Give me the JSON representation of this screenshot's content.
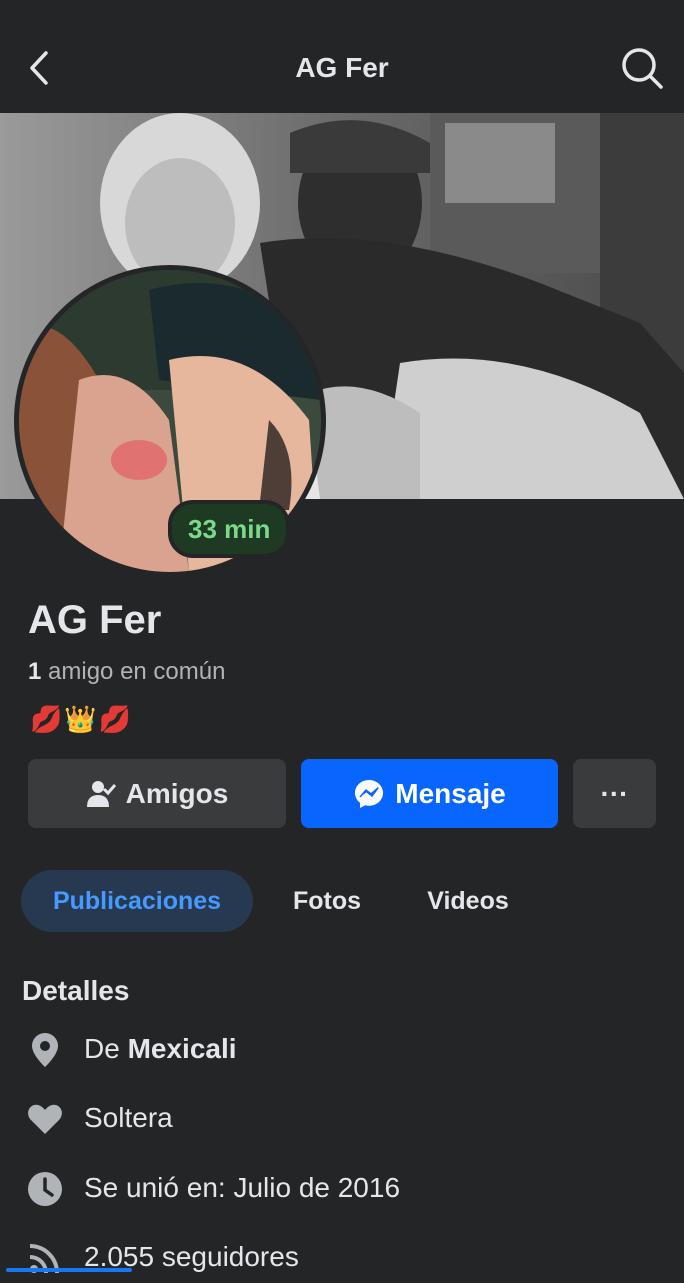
{
  "header": {
    "title": "AG Fer",
    "back_icon": "chevron-left-icon",
    "search_icon": "search-icon"
  },
  "profile": {
    "name": "AG Fer",
    "active_badge": "33 min",
    "mutual_count": "1",
    "mutual_text": " amigo en común",
    "bio": "💋👑💋"
  },
  "actions": {
    "friends_label": "Amigos",
    "message_label": "Mensaje",
    "more_label": "···"
  },
  "tabs": [
    {
      "label": "Publicaciones",
      "active": true
    },
    {
      "label": "Fotos",
      "active": false
    },
    {
      "label": "Videos",
      "active": false
    }
  ],
  "details": {
    "title": "Detalles",
    "hometown_prefix": "De ",
    "hometown": "Mexicali",
    "relationship": "Soltera",
    "joined": "Se unió en: Julio de 2016",
    "followers": "2.055 seguidores"
  },
  "colors": {
    "background": "#242526",
    "accent": "#0866ff",
    "active_tab_text": "#4599ff",
    "active_badge_text": "#7bd98b"
  }
}
